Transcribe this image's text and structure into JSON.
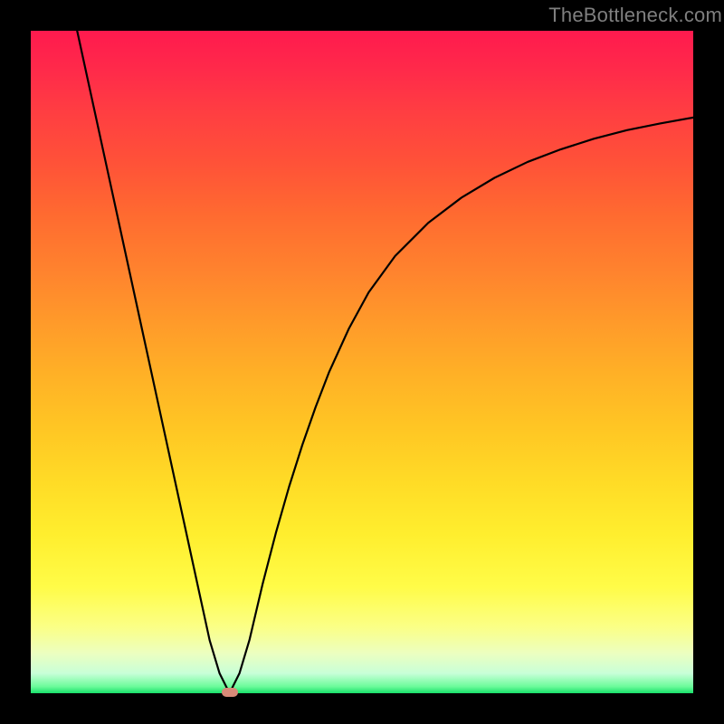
{
  "watermark": {
    "text": "TheBottleneck.com"
  },
  "colors": {
    "frame": "#000000",
    "curve": "#000000",
    "marker": "#d88a78",
    "watermark_text": "#7f7f7f",
    "gradient_top": "#ff1a4e",
    "gradient_bottom": "#18e06a"
  },
  "chart_data": {
    "type": "line",
    "title": "",
    "xlabel": "",
    "ylabel": "",
    "xlim": [
      0,
      100
    ],
    "ylim": [
      0,
      100
    ],
    "grid": false,
    "legend": false,
    "annotations": [
      "TheBottleneck.com"
    ],
    "series": [
      {
        "name": "bottleneck-curve",
        "color": "#000000",
        "x": [
          7,
          9,
          11,
          13,
          15,
          17,
          19,
          21,
          23,
          25,
          27,
          28.5,
          30,
          31.5,
          33,
          35,
          37,
          39,
          41,
          43,
          45,
          48,
          51,
          55,
          60,
          65,
          70,
          75,
          80,
          85,
          90,
          95,
          100
        ],
        "y": [
          100,
          90.8,
          81.6,
          72.4,
          63.2,
          54.0,
          44.8,
          35.6,
          26.4,
          17.2,
          8.0,
          3.0,
          0.0,
          3.0,
          8.0,
          16.5,
          24.2,
          31.2,
          37.5,
          43.2,
          48.4,
          55.0,
          60.5,
          66.0,
          71.0,
          74.8,
          77.8,
          80.2,
          82.1,
          83.7,
          85.0,
          86.0,
          86.9
        ]
      }
    ],
    "marker": {
      "x": 30,
      "y": 0,
      "color": "#d88a78"
    }
  }
}
